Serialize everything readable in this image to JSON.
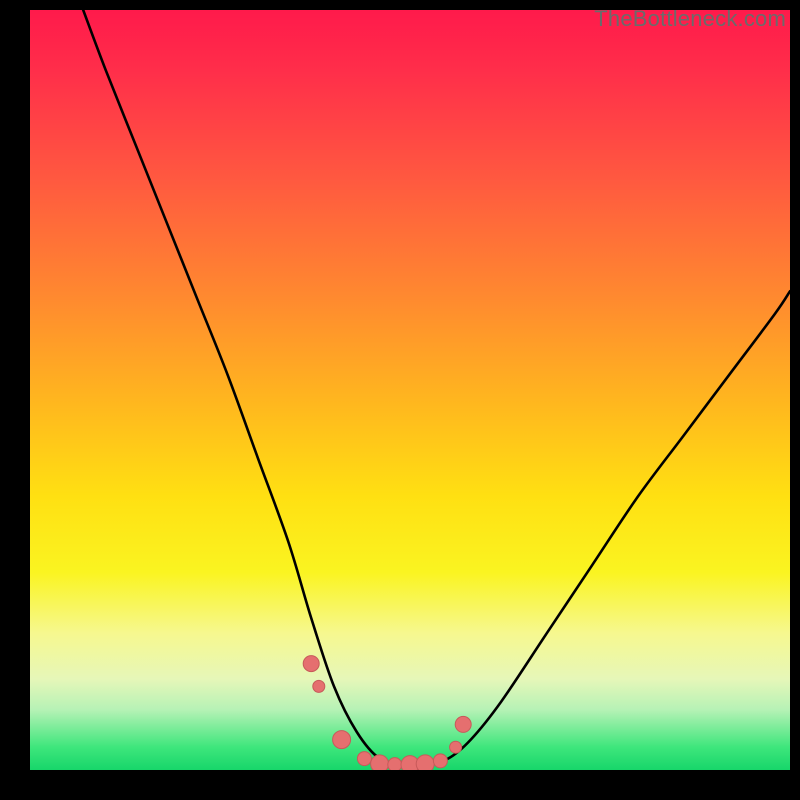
{
  "watermark": "TheBottleneck.com",
  "colors": {
    "frame": "#000000",
    "curve": "#000000",
    "marker_fill": "#e56f6f",
    "marker_stroke": "#c75a5a",
    "gradient_top": "#ff1a4b",
    "gradient_bottom": "#17d66a"
  },
  "chart_data": {
    "type": "line",
    "title": "",
    "xlabel": "",
    "ylabel": "",
    "xlim": [
      0,
      100
    ],
    "ylim": [
      0,
      100
    ],
    "grid": false,
    "legend": false,
    "notes": "V-shaped bottleneck curve. Y values decrease steeply from the upper-left, reach ~0 in a flat trough around x≈40–55, then rise again toward the right edge reaching roughly 60–65. Small salmon-colored markers sit along the trough.",
    "series": [
      {
        "name": "curve",
        "x": [
          7,
          10,
          14,
          18,
          22,
          26,
          30,
          34,
          37,
          40,
          43,
          46,
          49,
          52,
          55,
          58,
          62,
          68,
          74,
          80,
          86,
          92,
          98,
          100
        ],
        "y": [
          100,
          92,
          82,
          72,
          62,
          52,
          41,
          30,
          20,
          11,
          5,
          1.5,
          0.8,
          0.8,
          1.5,
          4,
          9,
          18,
          27,
          36,
          44,
          52,
          60,
          63
        ]
      }
    ],
    "markers": {
      "name": "highlight-points",
      "x": [
        37,
        38,
        41,
        44,
        46,
        48,
        50,
        52,
        54,
        56,
        57
      ],
      "y": [
        14,
        11,
        4,
        1.5,
        0.8,
        0.7,
        0.7,
        0.8,
        1.2,
        3,
        6
      ],
      "r": [
        8,
        6,
        9,
        7,
        9,
        7,
        9,
        9,
        7,
        6,
        8
      ]
    }
  }
}
